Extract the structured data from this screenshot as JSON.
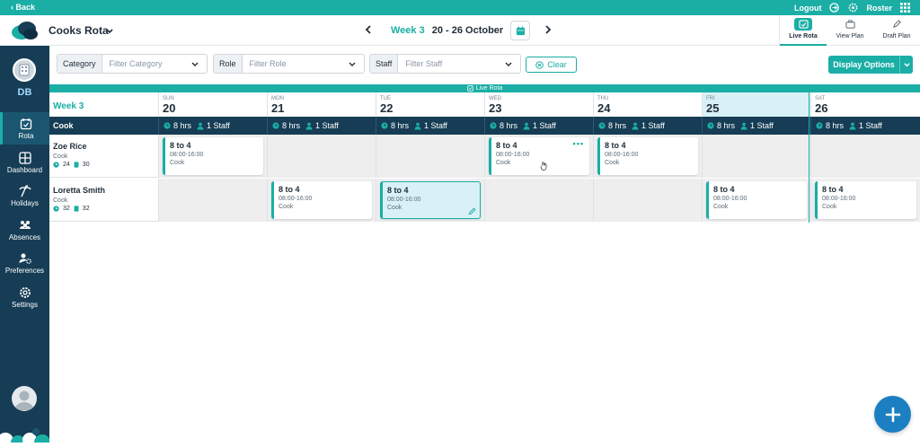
{
  "topbar": {
    "back_label": "‹ Back",
    "logout_label": "Logout",
    "roster_label": "Roster"
  },
  "header": {
    "app_title": "Cooks Rota",
    "week_label": "Week 3",
    "week_range": "20 - 26 October",
    "views": [
      {
        "label": "Live Rota",
        "icon": "live-rota-icon",
        "active": true
      },
      {
        "label": "View Plan",
        "icon": "view-plan-icon",
        "active": false
      },
      {
        "label": "Draft Plan",
        "icon": "draft-plan-icon",
        "active": false
      }
    ]
  },
  "sidebar": {
    "initials": "DB",
    "items": [
      {
        "label": "Rota",
        "icon": "calendar-check-icon",
        "active": true
      },
      {
        "label": "Dashboard",
        "icon": "dashboard-icon",
        "active": false
      },
      {
        "label": "Holidays",
        "icon": "holidays-icon",
        "active": false
      },
      {
        "label": "Absences",
        "icon": "absences-icon",
        "active": false
      },
      {
        "label": "Preferences",
        "icon": "preferences-icon",
        "active": false
      },
      {
        "label": "Settings",
        "icon": "settings-icon",
        "active": false
      }
    ]
  },
  "filters": {
    "category_label": "Category",
    "category_placeholder": "Filter Category",
    "role_label": "Role",
    "role_placeholder": "Filter Role",
    "staff_label": "Staff",
    "staff_placeholder": "Filter Staff",
    "clear_label": "Clear",
    "display_options_label": "Display Options"
  },
  "live_strip_label": "Live Rota",
  "grid": {
    "week_label": "Week 3",
    "role_name": "Cook",
    "days": [
      {
        "name": "SUN",
        "num": "20",
        "hours": "8 hrs",
        "staff": "1 Staff"
      },
      {
        "name": "MON",
        "num": "21",
        "hours": "8 hrs",
        "staff": "1 Staff"
      },
      {
        "name": "TUE",
        "num": "22",
        "hours": "8 hrs",
        "staff": "1 Staff"
      },
      {
        "name": "WED",
        "num": "23",
        "hours": "8 hrs",
        "staff": "1 Staff"
      },
      {
        "name": "THU",
        "num": "24",
        "hours": "8 hrs",
        "staff": "1 Staff"
      },
      {
        "name": "FRI",
        "num": "25",
        "hours": "8 hrs",
        "staff": "1 Staff"
      },
      {
        "name": "SAT",
        "num": "26",
        "hours": "8 hrs",
        "staff": "1 Staff"
      }
    ],
    "staff": [
      {
        "name": "Zoe Rice",
        "role": "Cook",
        "stat_a": "24",
        "stat_b": "30",
        "shifts": [
          {
            "title": "8 to 4",
            "time": "08:00-16:00",
            "role": "Cook"
          },
          null,
          null,
          {
            "title": "8 to 4",
            "time": "08:00-16:00",
            "role": "Cook"
          },
          {
            "title": "8 to 4",
            "time": "08:00-16:00",
            "role": "Cook"
          },
          null,
          null
        ]
      },
      {
        "name": "Loretta Smith",
        "role": "Cook",
        "stat_a": "32",
        "stat_b": "32",
        "shifts": [
          null,
          {
            "title": "8 to 4",
            "time": "08:00-16:00",
            "role": "Cook"
          },
          {
            "title": "8 to 4",
            "time": "08:00-16:00",
            "role": "Cook"
          },
          null,
          null,
          {
            "title": "8 to 4",
            "time": "08:00-16:00",
            "role": "Cook"
          },
          {
            "title": "8 to 4",
            "time": "08:00-16:00",
            "role": "Cook"
          }
        ]
      }
    ]
  },
  "colors": {
    "accent": "#1aaea5",
    "sidebar": "#163d55",
    "fab": "#1c7fc1"
  }
}
